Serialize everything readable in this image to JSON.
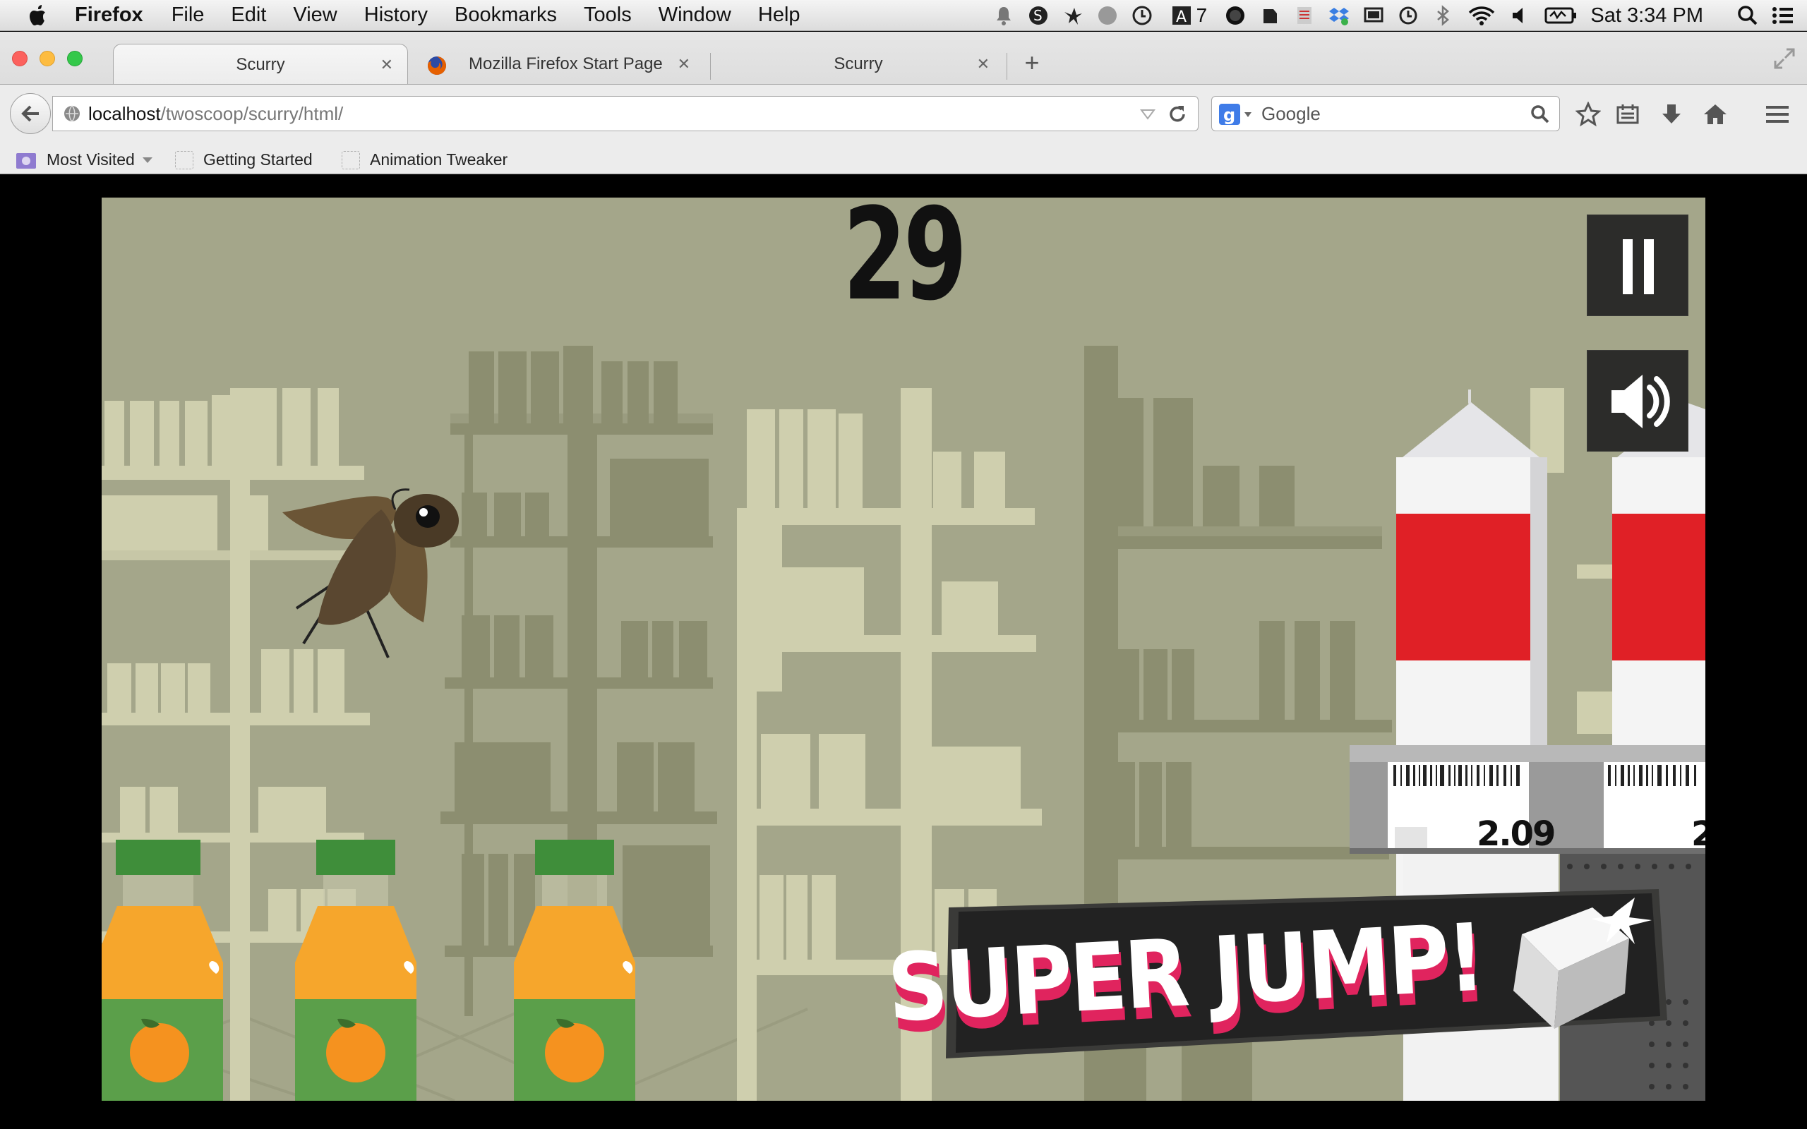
{
  "menubar": {
    "app": "Firefox",
    "items": [
      "File",
      "Edit",
      "View",
      "History",
      "Bookmarks",
      "Tools",
      "Window",
      "Help"
    ],
    "status_icons": [
      "bell-icon",
      "scrivener-icon",
      "bird-icon",
      "cloud-icon",
      "clock-app-icon",
      "adobe-icon",
      "record-icon",
      "evernote-icon",
      "notes-icon",
      "dropbox-icon",
      "display-icon",
      "time-machine-icon",
      "bluetooth-icon",
      "wifi-icon",
      "volume-icon",
      "battery-icon"
    ],
    "adobe_badge": "7",
    "clock": "Sat 3:34 PM"
  },
  "browser": {
    "tabs": [
      {
        "label": "Scurry",
        "active": true
      },
      {
        "label": "Mozilla Firefox Start Page",
        "active": false
      },
      {
        "label": "Scurry",
        "active": false
      }
    ],
    "url_host": "localhost",
    "url_path": "/twoscoop/scurry/html/",
    "search_placeholder": "Google",
    "bookmarks": [
      "Most Visited",
      "Getting Started",
      "Animation Tweaker"
    ]
  },
  "game": {
    "score": "29",
    "price_1": "2.09",
    "price_2": "2",
    "banner": "SUPER JUMP!",
    "colors": {
      "bg": "#a4a68a",
      "shelf_light": "#cfcfae",
      "shelf_dark": "#8c8e70",
      "juice": "#f6a62c",
      "label": "#5b9f4a",
      "carton_red": "#e02026"
    }
  }
}
